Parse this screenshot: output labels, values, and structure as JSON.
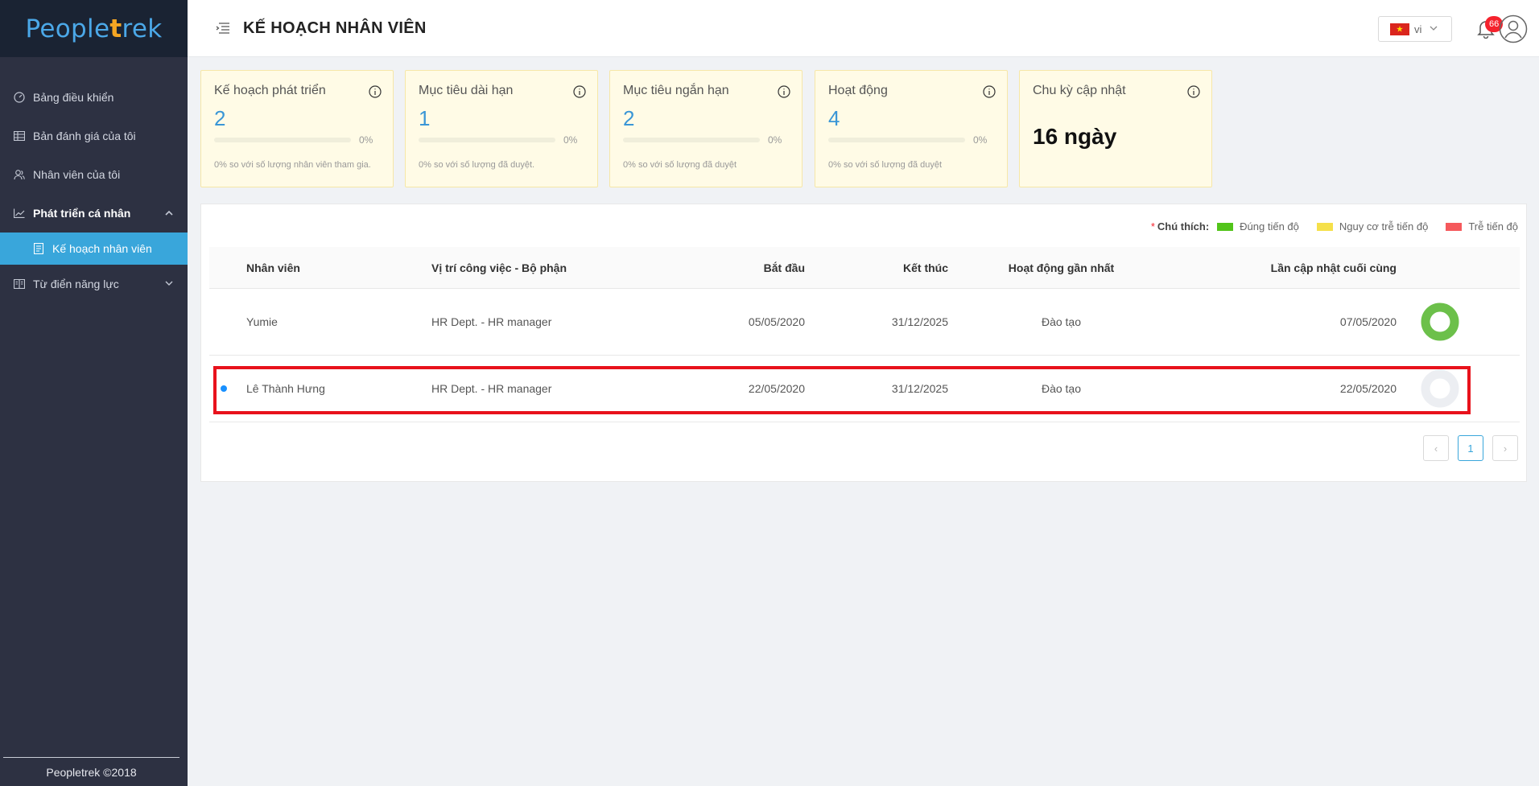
{
  "sidebar": {
    "logo_prefix": "People",
    "logo_t": "t",
    "logo_suffix": "rek",
    "items": [
      {
        "label": "Bảng điều khiển",
        "icon": "dashboard-icon"
      },
      {
        "label": "Bản đánh giá của tôi",
        "icon": "table-icon"
      },
      {
        "label": "Nhân viên của tôi",
        "icon": "users-icon"
      },
      {
        "label": "Phát triển cá nhân",
        "icon": "chart-line-icon",
        "expanded": true
      },
      {
        "label": "Kế hoạch nhân viên",
        "icon": "document-icon",
        "active": true
      },
      {
        "label": "Từ điển năng lực",
        "icon": "book-icon"
      }
    ],
    "footer": "Peopletrek ©2018"
  },
  "header": {
    "title": "KẾ HOẠCH NHÂN VIÊN",
    "language": "vi",
    "notification_count": "66"
  },
  "cards": [
    {
      "title": "Kế hoạch phát triển",
      "value": "2",
      "progress": 0,
      "percent": "0%",
      "note": "0% so với số lượng nhân viên tham gia."
    },
    {
      "title": "Mục tiêu dài hạn",
      "value": "1",
      "progress": 0,
      "percent": "0%",
      "note": "0% so với số lượng đã duyệt."
    },
    {
      "title": "Mục tiêu ngắn hạn",
      "value": "2",
      "progress": 0,
      "percent": "0%",
      "note": "0% so với số lượng đã duyệt"
    },
    {
      "title": "Hoạt động",
      "value": "4",
      "progress": 0,
      "percent": "0%",
      "note": "0% so với số lượng đã duyệt"
    },
    {
      "title": "Chu kỳ cập nhật",
      "big_value": "16 ngày"
    }
  ],
  "legend": {
    "required_mark": "*",
    "label": "Chú thích:",
    "items": [
      {
        "text": "Đúng tiến độ",
        "color": "#52c41a"
      },
      {
        "text": "Nguy cơ trễ tiến độ",
        "color": "#f5e04a"
      },
      {
        "text": "Trễ tiến độ",
        "color": "#f5595c"
      }
    ]
  },
  "table": {
    "headers": {
      "employee": "Nhân viên",
      "position": "Vị trí công việc - Bộ phận",
      "start": "Bắt đầu",
      "end": "Kết thúc",
      "recent_activity": "Hoạt động gần nhất",
      "last_update": "Lần cập nhật cuối cùng"
    },
    "rows": [
      {
        "employee": "Yumie",
        "position": "HR Dept. - HR manager",
        "start": "05/05/2020",
        "end": "31/12/2025",
        "recent_activity": "Đào tạo",
        "last_update": "07/05/2020",
        "status_color": "#6cc04a",
        "unread": false
      },
      {
        "employee": "Lê Thành Hưng",
        "position": "HR Dept. - HR manager",
        "start": "22/05/2020",
        "end": "31/12/2025",
        "recent_activity": "Đào tạo",
        "last_update": "22/05/2020",
        "status_color": "#eceef2",
        "unread": true
      }
    ]
  },
  "pagination": {
    "prev": "‹",
    "current": "1",
    "next": "›"
  },
  "colors": {
    "accent": "#39a6db",
    "sidebar_bg": "#2d3142",
    "card_bg": "#fffbe6",
    "highlight": "#e8121c"
  }
}
